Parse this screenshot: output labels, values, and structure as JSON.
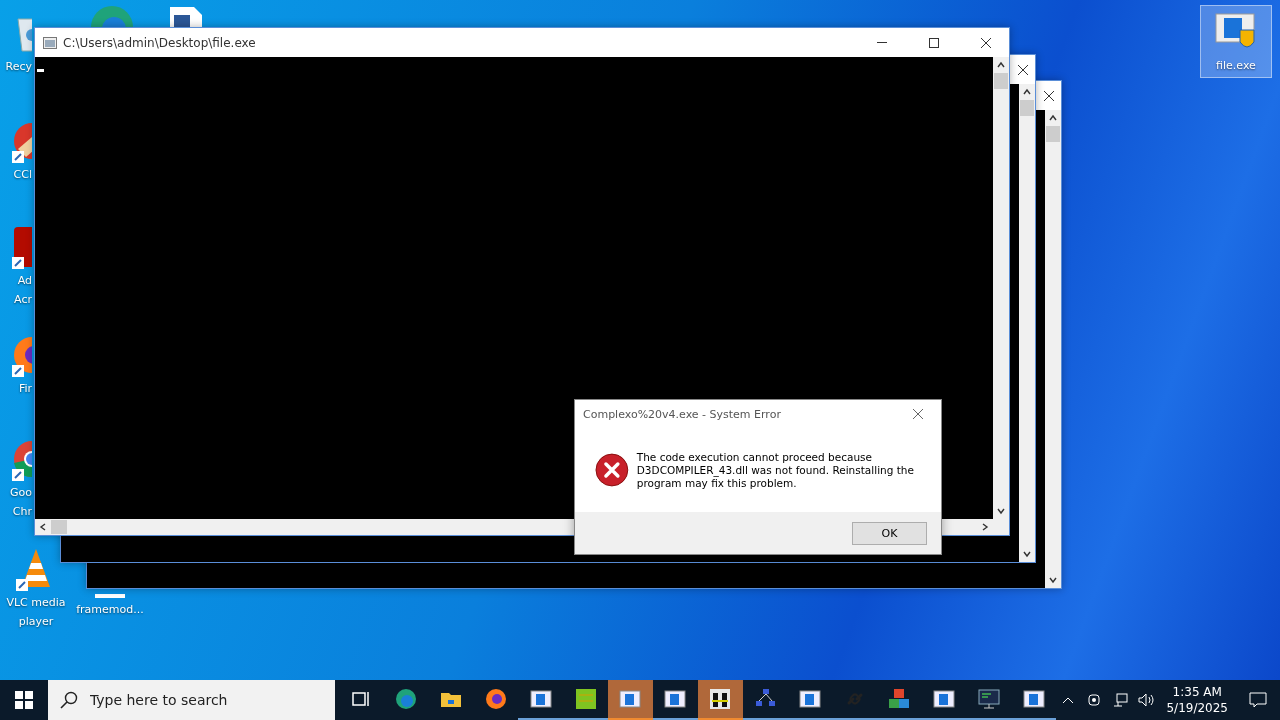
{
  "desktop_icons": [
    {
      "kind": "recycle",
      "lines": [
        "Recy"
      ],
      "selected": false
    },
    {
      "kind": "edge"
    },
    {
      "kind": "document"
    },
    {
      "kind": "ccleaner",
      "lines": [
        "CCl"
      ],
      "selected": false
    },
    {
      "kind": "acrobat",
      "lines": [
        "Ad",
        "Acr"
      ],
      "selected": false
    },
    {
      "kind": "firefox",
      "lines": [
        "Fir"
      ],
      "selected": false
    },
    {
      "kind": "chrome",
      "lines": [
        "Goo",
        "Chr"
      ],
      "selected": false
    },
    {
      "kind": "vlc",
      "lines": [
        "VLC media",
        "player"
      ],
      "selected": false
    },
    {
      "kind": "blank",
      "lines": [
        "framemod..."
      ],
      "selected": false
    },
    {
      "kind": "exe",
      "lines": [
        "file.exe"
      ],
      "selected": true
    }
  ],
  "consoles": [
    {
      "kind": "front",
      "title": "C:\\Users\\admin\\Desktop\\file.exe",
      "cursor": true
    },
    {
      "kind": "behind"
    },
    {
      "kind": "behind"
    }
  ],
  "dialog": {
    "title": "Complexo%20v4.exe - System Error",
    "message": "The code execution cannot proceed because D3DCOMPILER_43.dll was not found. Reinstalling the program may fix this problem.",
    "button": "OK"
  },
  "taskbar": {
    "search": {
      "placeholder": "Type here to search"
    },
    "apps": [
      {
        "kind": "taskview",
        "running": false,
        "selected": false
      },
      {
        "kind": "edge",
        "running": false,
        "selected": false
      },
      {
        "kind": "explorer",
        "running": false,
        "selected": false
      },
      {
        "kind": "firefox",
        "running": false,
        "selected": false
      },
      {
        "kind": "window",
        "running": true,
        "selected": false
      },
      {
        "kind": "green",
        "running": true,
        "selected": false
      },
      {
        "kind": "window",
        "running": true,
        "selected": true
      },
      {
        "kind": "window",
        "running": true,
        "selected": false
      },
      {
        "kind": "binoculars",
        "running": true,
        "selected": true
      },
      {
        "kind": "network",
        "running": true,
        "selected": false
      },
      {
        "kind": "window",
        "running": true,
        "selected": false
      },
      {
        "kind": "link",
        "running": true,
        "selected": false
      },
      {
        "kind": "cubes",
        "running": true,
        "selected": false
      },
      {
        "kind": "window",
        "running": true,
        "selected": false
      },
      {
        "kind": "monitor",
        "running": true,
        "selected": false
      },
      {
        "kind": "window",
        "running": true,
        "selected": false
      }
    ],
    "time": "1:35 AM",
    "date": "5/19/2025"
  }
}
